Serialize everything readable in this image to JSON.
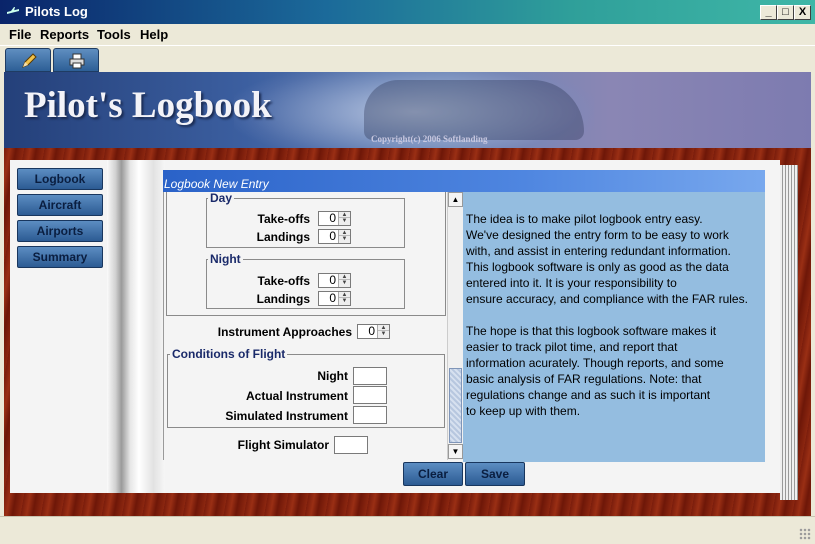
{
  "window": {
    "title": "Pilots Log",
    "controls": [
      "_",
      "□",
      "X"
    ]
  },
  "menu": [
    "File",
    "Reports",
    "Tools",
    "Help"
  ],
  "toolbar": {
    "buttons": [
      {
        "icon": "pencil-icon"
      },
      {
        "icon": "printer-icon"
      }
    ]
  },
  "banner": {
    "title": "Pilot's Logbook",
    "copyright": "Copyright(c) 2006 Softlanding"
  },
  "sidebar": {
    "items": [
      "Logbook",
      "Aircraft",
      "Airports",
      "Summary"
    ]
  },
  "panel": {
    "title": "Logbook New Entry"
  },
  "form": {
    "day": {
      "title": "Day",
      "takeoffs_label": "Take-offs",
      "takeoffs_value": "0",
      "landings_label": "Landings",
      "landings_value": "0"
    },
    "night": {
      "title": "Night",
      "takeoffs_label": "Take-offs",
      "takeoffs_value": "0",
      "landings_label": "Landings",
      "landings_value": "0"
    },
    "instrument_approaches": {
      "label": "Instrument Approaches",
      "value": "0"
    },
    "conditions": {
      "title": "Conditions of Flight",
      "night_label": "Night",
      "night_value": "",
      "actual_label": "Actual Instrument",
      "actual_value": "",
      "simulated_label": "Simulated Instrument",
      "simulated_value": ""
    },
    "flight_simulator": {
      "label": "Flight Simulator",
      "value": ""
    }
  },
  "info": {
    "para1": "The idea is to make pilot logbook entry easy.\nWe've designed the entry form to be easy to work\nwith, and assist in entering redundant information.\nThis logbook software is only as good as the data\nentered into it. It is your responsibility to\nensure accuracy, and compliance with the FAR rules.",
    "para2": "The hope is that this logbook software makes it\neasier to track pilot time, and report that\ninformation acurately. Though reports, and some\nbasic analysis of FAR regulations. Note: that\nregulations change and as such it is important\nto keep up with them."
  },
  "actions": {
    "clear_label": "Clear",
    "save_label": "Save"
  },
  "colors": {
    "info_bg": "#94bde0",
    "header_blue": "#2a62c8",
    "button_blue": "#3b6aa3",
    "wood": "#8c2710"
  }
}
